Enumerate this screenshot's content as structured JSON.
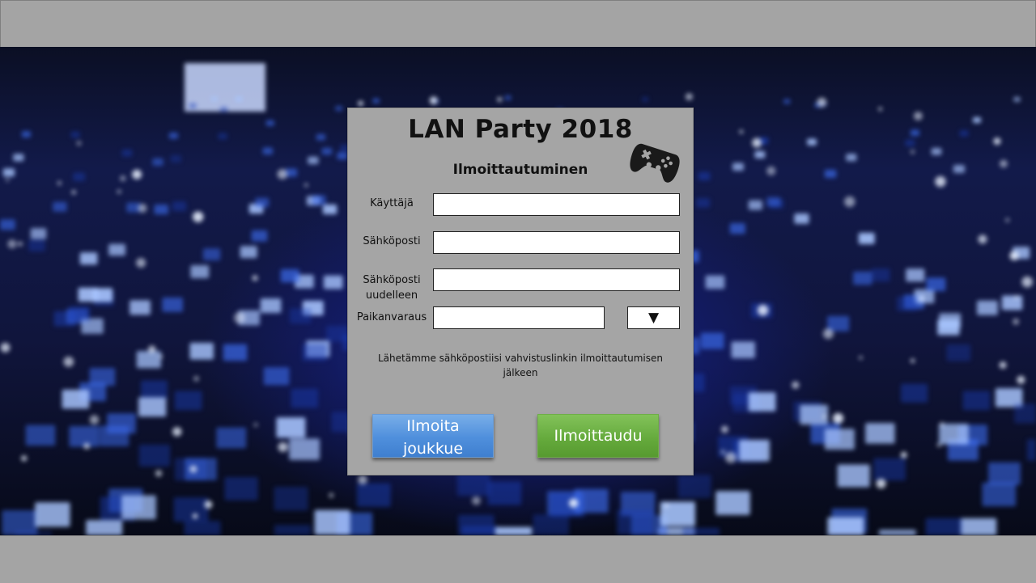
{
  "form": {
    "title": "LAN Party 2018",
    "subtitle": "Ilmoittautuminen",
    "fields": {
      "username": {
        "label": "Käyttäjä",
        "value": "",
        "placeholder": ""
      },
      "email": {
        "label": "Sähköposti",
        "value": "",
        "placeholder": ""
      },
      "email_confirm": {
        "label_line1": "Sähköposti",
        "label_line2": "uudelleen",
        "value": "",
        "placeholder": ""
      },
      "seat": {
        "label": "Paikanvaraus",
        "value": "",
        "placeholder": ""
      }
    },
    "dropdown_glyph": "▼",
    "note_line1": "Lähetämme sähköpostiisi  vahvistuslinkin  ilmoittautumisen",
    "note_line2": "jälkeen",
    "buttons": {
      "team_line1": "Ilmoita",
      "team_line2": "joukkue",
      "register": "Ilmoittaudu"
    }
  },
  "icons": {
    "gamepad": "gamepad-icon"
  },
  "colors": {
    "panel_bg": "#a5a5a5",
    "team_button": "#5a95dc",
    "register_button": "#69ad40",
    "frame_bg": "#a4a4a4"
  }
}
